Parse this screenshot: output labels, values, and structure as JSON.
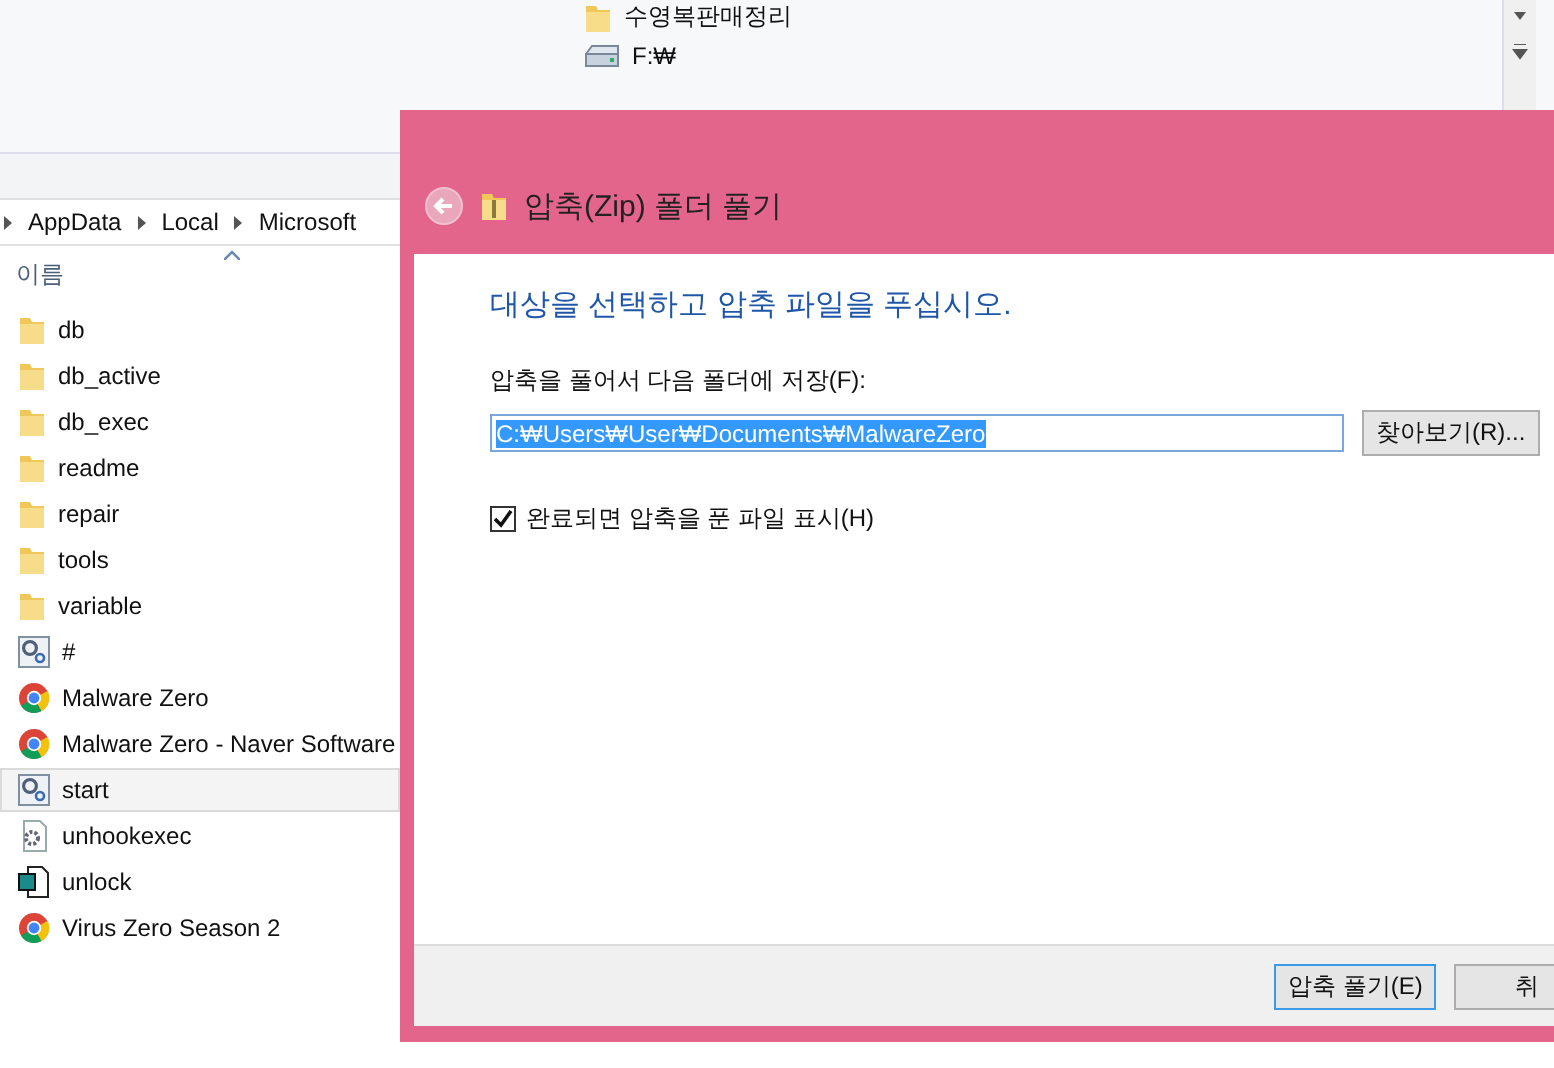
{
  "nav_tree": {
    "items": [
      {
        "label": "수영복판매정리",
        "kind": "folder"
      },
      {
        "label": "F:₩",
        "kind": "drive"
      }
    ]
  },
  "breadcrumb": [
    "AppData",
    "Local",
    "Microsoft"
  ],
  "file_list": {
    "column": "이름",
    "items": [
      {
        "name": "db",
        "kind": "folder",
        "hovered": false
      },
      {
        "name": "db_active",
        "kind": "folder",
        "hovered": false
      },
      {
        "name": "db_exec",
        "kind": "folder",
        "hovered": false
      },
      {
        "name": "readme",
        "kind": "folder",
        "hovered": false
      },
      {
        "name": "repair",
        "kind": "folder",
        "hovered": false
      },
      {
        "name": "tools",
        "kind": "folder",
        "hovered": false
      },
      {
        "name": "variable",
        "kind": "folder",
        "hovered": false
      },
      {
        "name": "#",
        "kind": "settings",
        "hovered": false
      },
      {
        "name": "Malware Zero",
        "kind": "browser",
        "hovered": false
      },
      {
        "name": "Malware Zero - Naver Software",
        "kind": "browser",
        "hovered": false
      },
      {
        "name": "start",
        "kind": "settings",
        "hovered": true
      },
      {
        "name": "unhookexec",
        "kind": "config",
        "hovered": false
      },
      {
        "name": "unlock",
        "kind": "script",
        "hovered": false
      },
      {
        "name": "Virus Zero Season 2",
        "kind": "browser",
        "hovered": false
      }
    ]
  },
  "dialog": {
    "title": "압축(Zip) 폴더 풀기",
    "heading": "대상을 선택하고 압축 파일을 푸십시오.",
    "destination_label": "압축을 풀어서 다음 폴더에 저장(F):",
    "destination_value": "C:₩Users₩User₩Documents₩MalwareZero",
    "browse_button": "찾아보기(R)...",
    "show_files": {
      "label": "완료되면 압축을 푼 파일 표시(H)",
      "checked": true
    },
    "buttons": [
      "압축 풀기(E)",
      "취"
    ]
  }
}
